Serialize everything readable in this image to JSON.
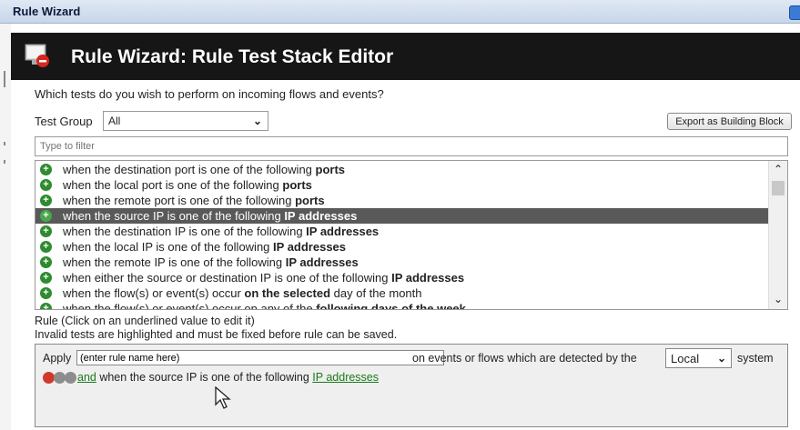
{
  "window": {
    "title": "Rule Wizard"
  },
  "header": {
    "title": "Rule Wizard: Rule Test Stack Editor",
    "icon": "rule-wizard-app-icon"
  },
  "question": "Which tests do you wish to perform on incoming flows and events?",
  "test_group": {
    "label": "Test Group",
    "value": "All"
  },
  "export_button": "Export as Building Block",
  "filter": {
    "placeholder": "Type to filter"
  },
  "tests": [
    {
      "pre": "when the destination port is one of the following ",
      "bold": "ports",
      "post": "",
      "selected": false
    },
    {
      "pre": "when the local port is one of the following ",
      "bold": "ports",
      "post": "",
      "selected": false
    },
    {
      "pre": "when the remote port is one of the following ",
      "bold": "ports",
      "post": "",
      "selected": false
    },
    {
      "pre": "when the source IP is one of the following ",
      "bold": "IP addresses",
      "post": "",
      "selected": true
    },
    {
      "pre": "when the destination IP is one of the following ",
      "bold": "IP addresses",
      "post": "",
      "selected": false
    },
    {
      "pre": "when the local IP is one of the following ",
      "bold": "IP addresses",
      "post": "",
      "selected": false
    },
    {
      "pre": "when the remote IP is one of the following ",
      "bold": "IP addresses",
      "post": "",
      "selected": false
    },
    {
      "pre": "when either the source or destination IP is one of the following ",
      "bold": "IP addresses",
      "post": "",
      "selected": false
    },
    {
      "pre": "when the flow(s) or event(s) occur ",
      "bold": "on the selected",
      "post": " day of the month",
      "selected": false
    },
    {
      "pre": "when the flow(s) or event(s) occur on any of the ",
      "bold": "following days of the week",
      "post": "",
      "selected": false
    }
  ],
  "rule_hint": {
    "line1": "Rule (Click on an underlined value to edit it)",
    "line2": "Invalid tests are highlighted and must be fixed before rule can be saved."
  },
  "rule": {
    "apply_label": "Apply",
    "name_value": "(enter rule name here)",
    "on_events_text": "on events or flows which are detected by the",
    "system_value": "Local",
    "system_text": "system",
    "and_link": "and",
    "test_text": " when the source IP is one of the following ",
    "ip_link": "IP addresses"
  }
}
